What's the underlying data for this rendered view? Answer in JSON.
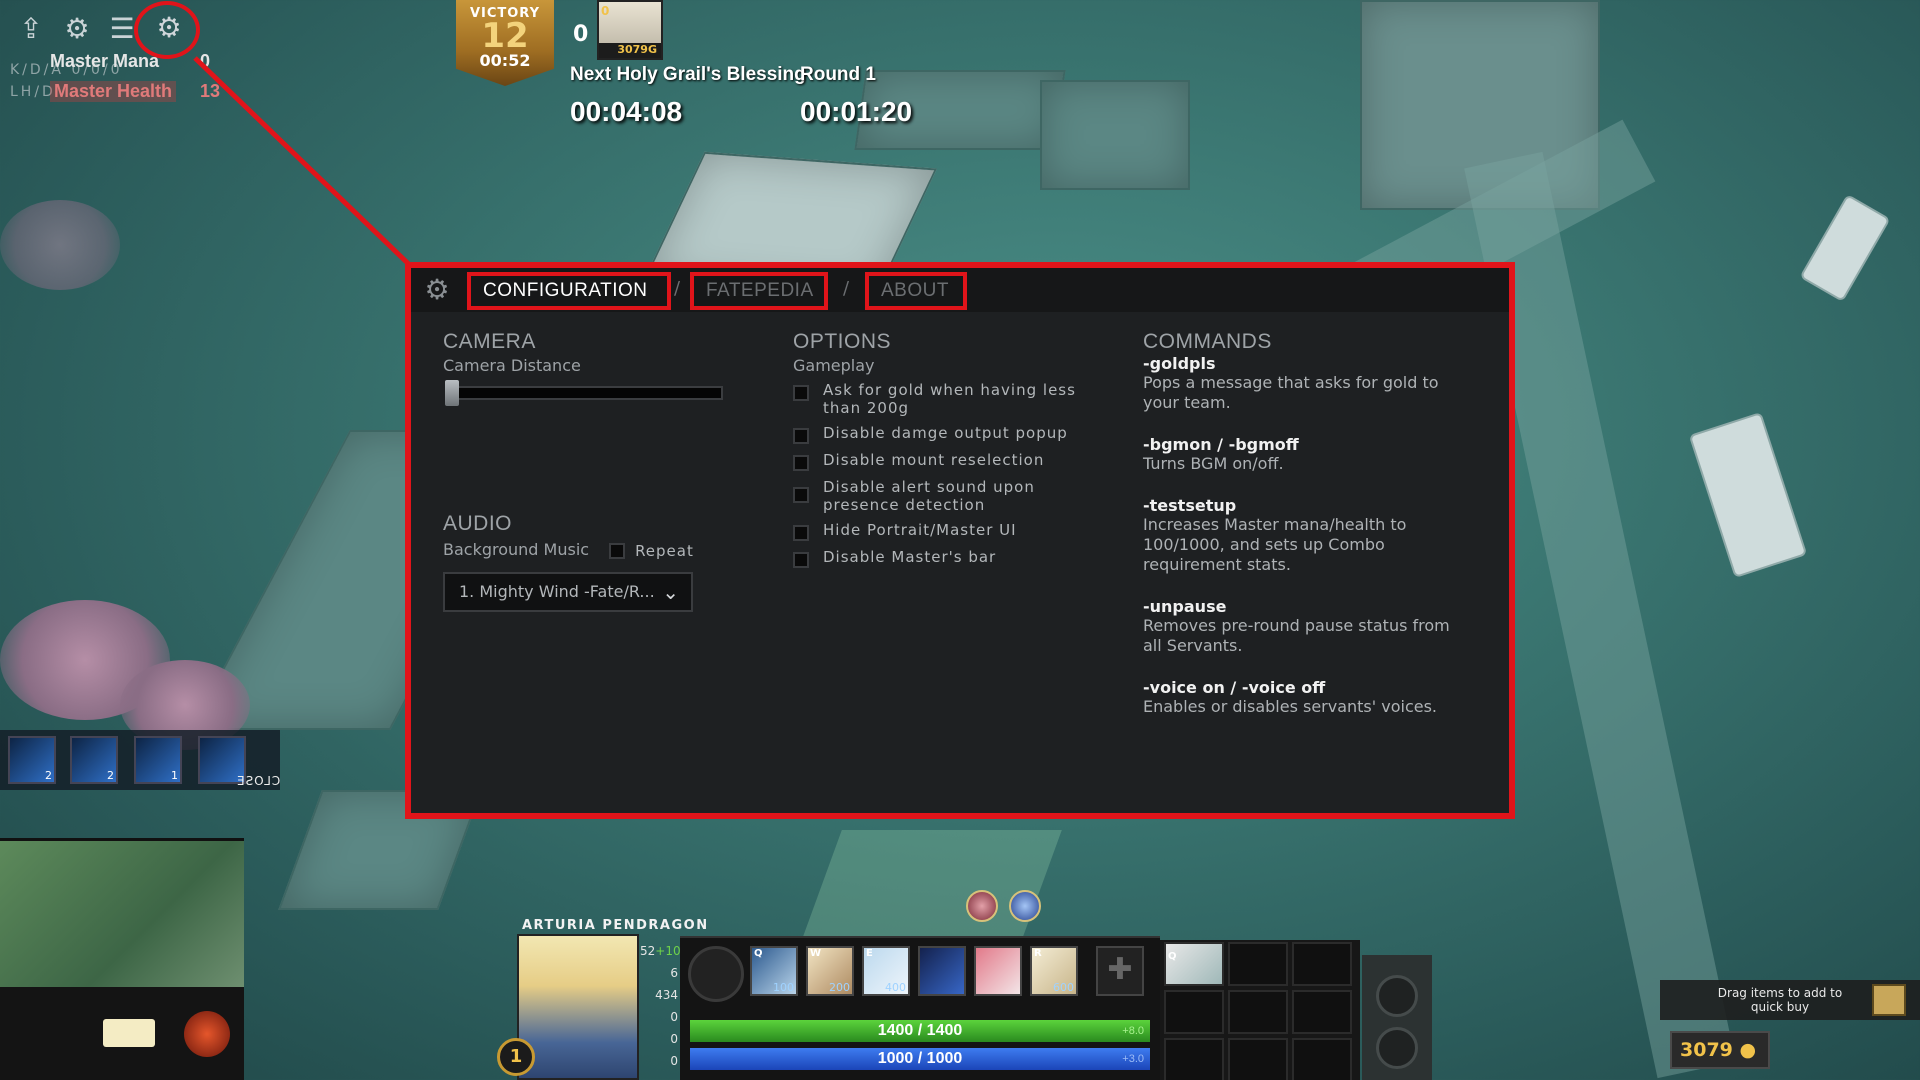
{
  "top_left_hud": {
    "master_mana_label": "Master Mana",
    "master_mana_value": "0",
    "master_health_label": "Master Health",
    "master_health_value": "13",
    "kda_label": "K/D/A",
    "kda_value": "0/0/0",
    "lhd_label": "LH/D",
    "icons": [
      "upload-icon",
      "gear-icon",
      "menu-icon",
      "settings-icon"
    ]
  },
  "top_center": {
    "victory_label": "VICTORY",
    "victory_count": "12",
    "victory_time": "00:52",
    "team_score": "0",
    "portrait_badge": "0",
    "portrait_gold": "3079G",
    "blessing_label": "Next Holy Grail's Blessing",
    "round_label": "Round 1",
    "blessing_timer": "00:04:08",
    "round_timer": "00:01:20"
  },
  "settings_panel": {
    "tabs": [
      {
        "label": "CONFIGURATION",
        "active": true
      },
      {
        "label": "FATEPEDIA",
        "active": false
      },
      {
        "label": "ABOUT",
        "active": false
      }
    ],
    "tab_separator": "/",
    "camera": {
      "title": "CAMERA",
      "distance_label": "Camera Distance",
      "distance_level": 0
    },
    "audio": {
      "title": "AUDIO",
      "bgm_label": "Background Music",
      "repeat_label": "Repeat",
      "selected_track": "1. Mighty Wind -Fate/R..."
    },
    "options": {
      "title": "OPTIONS",
      "subtitle": "Gameplay",
      "items": [
        "Ask for gold when having less than 200g",
        "Disable damge output popup",
        "Disable mount reselection",
        "Disable alert sound upon presence detection",
        "Hide Portrait/Master UI",
        "Disable Master's bar"
      ]
    },
    "commands": {
      "title": "COMMANDS",
      "items": [
        {
          "name": "-goldpls",
          "desc": "Pops a message that asks for gold to your team."
        },
        {
          "name": "-bgmon / -bgmoff",
          "desc": "Turns BGM on/off."
        },
        {
          "name": "-testsetup",
          "desc": "Increases Master mana/health to 100/1000, and sets up Combo requirement stats."
        },
        {
          "name": "-unpause",
          "desc": "Removes pre-round pause status from all Servants."
        },
        {
          "name": "-voice on / -voice off",
          "desc": "Enables or disables servants' voices."
        }
      ]
    }
  },
  "left_abilities": {
    "counts": [
      "2",
      "2",
      "1",
      ""
    ],
    "close_label": "CLOSE"
  },
  "hero": {
    "name": "ARTURIA PENDRAGON",
    "level": "1",
    "stats": [
      {
        "value": "52",
        "bonus": "+10"
      },
      {
        "value": "6",
        "bonus": ""
      },
      {
        "value": "434",
        "bonus": ""
      },
      {
        "value": "0",
        "bonus": ""
      },
      {
        "value": "0",
        "bonus": ""
      },
      {
        "value": "0",
        "bonus": ""
      }
    ],
    "skills": [
      {
        "key": "Q",
        "cost": "100"
      },
      {
        "key": "W",
        "cost": "200"
      },
      {
        "key": "E",
        "cost": "400"
      },
      {
        "key": "",
        "cost": ""
      },
      {
        "key": "",
        "cost": ""
      },
      {
        "key": "R",
        "cost": "600"
      }
    ],
    "health": "1400 / 1400",
    "health_regen": "+8.0",
    "mana": "1000 / 1000",
    "mana_regen": "+3.0",
    "extra_slot_key": "Q"
  },
  "shop": {
    "quickbuy_text": "Drag items to add to quick buy",
    "gold": "3079"
  },
  "colors": {
    "highlight": "#e0141a",
    "panel_bg": "#1e2022",
    "hp": "#3fae2a",
    "mp": "#2a5fd8",
    "gold": "#f1c24a"
  }
}
